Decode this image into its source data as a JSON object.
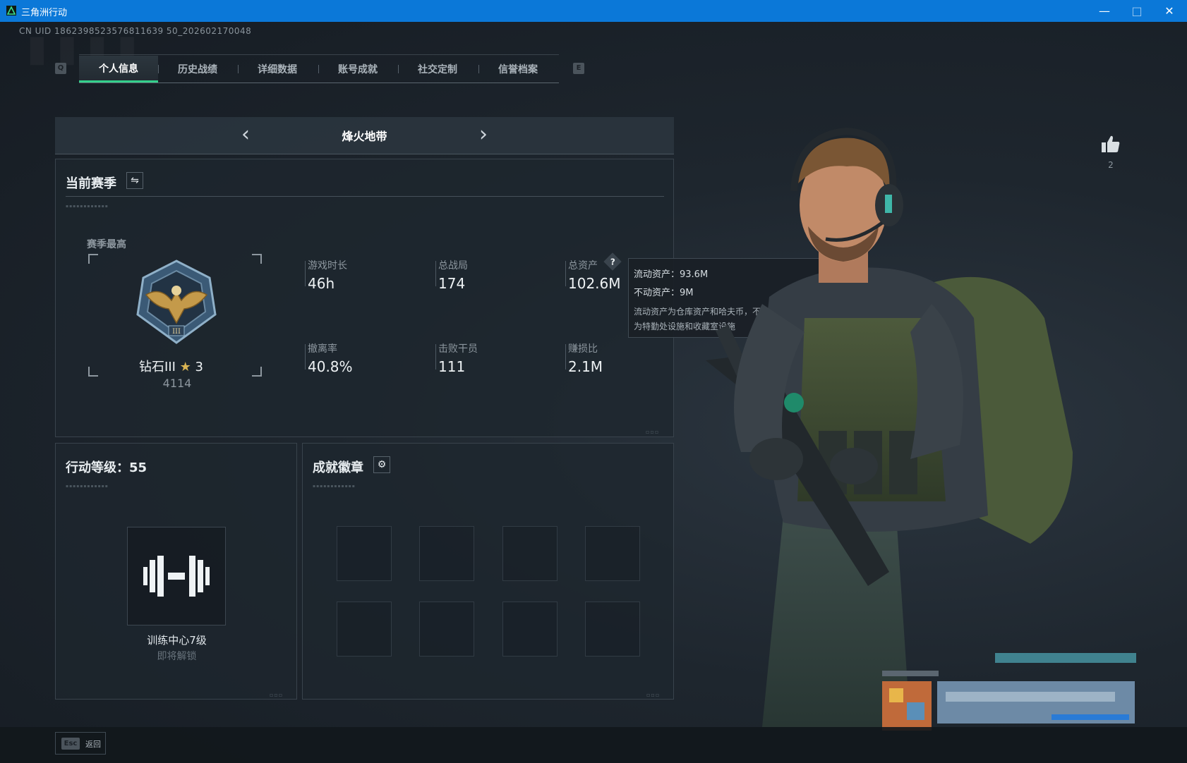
{
  "window": {
    "title": "三角洲行动",
    "minimize": "—",
    "maximize": "□",
    "close": "✕"
  },
  "uid": "CN UID 1862398523576811639 50_202602170048",
  "tabs": {
    "left_key": "Q",
    "right_key": "E",
    "items": [
      "个人信息",
      "历史战绩",
      "详细数据",
      "账号成就",
      "社交定制",
      "信誉档案"
    ],
    "active": "个人信息"
  },
  "mode": {
    "title": "烽火地带",
    "prev": "‹",
    "next": "›"
  },
  "season": {
    "title": "当前赛季",
    "switch_icon": "⇋",
    "best_label": "赛季最高",
    "rank": "钻石III",
    "stars": "3",
    "rank_score": "4114",
    "stats": [
      {
        "label": "游戏时长",
        "value": "46h"
      },
      {
        "label": "总战局",
        "value": "174"
      },
      {
        "label": "总资产",
        "value": "102.6M"
      },
      {
        "label": "撤离率",
        "value": "40.8%"
      },
      {
        "label": "击败干员",
        "value": "111"
      },
      {
        "label": "赚损比",
        "value": "2.1M"
      }
    ],
    "help_icon": "?"
  },
  "tooltip": {
    "liquid": "流动资产：93.6M",
    "fixed": "不动资产：9M",
    "note_line1": "流动资产为仓库资产和哈夫币，不动资产",
    "note_line2": "为特勤处设施和收藏室设施"
  },
  "level": {
    "title": "行动等级：55",
    "unlock_name": "训练中心7级",
    "unlock_status": "即将解锁"
  },
  "badges": {
    "title": "成就徽章",
    "settings_icon": "⚙"
  },
  "likes": {
    "count": "2"
  },
  "footer": {
    "esc_key": "Esc",
    "back_label": "返回"
  },
  "colors": {
    "accent": "#34d08c",
    "titlebar": "#0b78d8"
  }
}
